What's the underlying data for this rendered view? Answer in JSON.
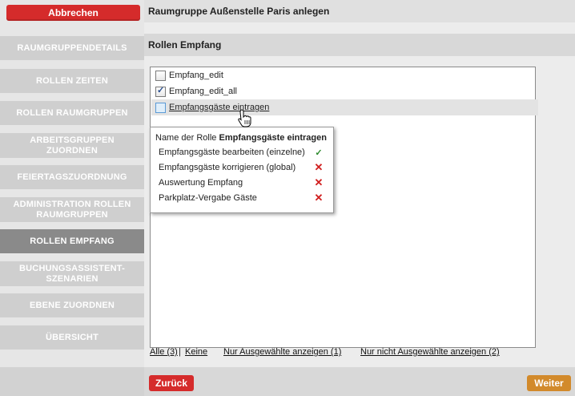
{
  "sidebar": {
    "cancel_label": "Abbrechen",
    "items": [
      {
        "label": "RAUMGRUPPENDETAILS"
      },
      {
        "label": "ROLLEN ZEITEN"
      },
      {
        "label": "ROLLEN RAUMGRUPPEN"
      },
      {
        "label": "ARBEITSGRUPPEN ZUORDNEN"
      },
      {
        "label": "FEIERTAGSZUORDNUNG"
      },
      {
        "label": "ADMINISTRATION ROLLEN RAUMGRUPPEN"
      },
      {
        "label": "ROLLEN EMPFANG"
      },
      {
        "label": "BUCHUNGSASSISTENT-SZENARIEN"
      },
      {
        "label": "EBENE ZUORDNEN"
      },
      {
        "label": "ÜBERSICHT"
      }
    ]
  },
  "header": {
    "title": "Raumgruppe Außenstelle Paris anlegen"
  },
  "section": {
    "title": "Rollen Empfang"
  },
  "roles": [
    {
      "label": "Empfang_edit",
      "checked": false
    },
    {
      "label": "Empfang_edit_all",
      "checked": true
    },
    {
      "label": "Empfangsgäste eintragen",
      "checked": false
    }
  ],
  "tooltip": {
    "prefix": "Name der Rolle ",
    "role_name": "Empfangsgäste eintragen",
    "rights": [
      {
        "label": "Empfangsgäste bearbeiten (einzelne)",
        "mark": "✓"
      },
      {
        "label": "Empfangsgäste korrigieren (global)",
        "mark": "✕"
      },
      {
        "label": "Auswertung Empfang",
        "mark": "✕"
      },
      {
        "label": "Parkplatz-Vergabe Gäste",
        "mark": "✕"
      }
    ]
  },
  "footer": {
    "all": "Alle (3)",
    "sep": " | ",
    "none": "Keine",
    "only_selected": "Nur Ausgewählte anzeigen (1)",
    "only_unselected": "Nur nicht Ausgewählte anzeigen (2)"
  },
  "buttons": {
    "back": "Zurück",
    "next": "Weiter"
  },
  "colors": {
    "red": "#d52b2b",
    "orange": "#d28a2b",
    "active_nav": "#8a8a8a"
  }
}
